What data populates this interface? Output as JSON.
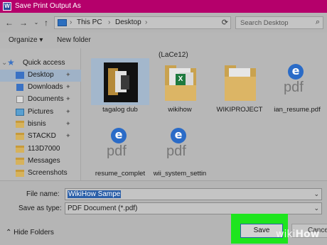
{
  "window": {
    "title": "Save Print Output As",
    "app_icon": "word-icon"
  },
  "address": {
    "segments": [
      "This PC",
      "Desktop"
    ],
    "search_placeholder": "Search Desktop"
  },
  "toolbar": {
    "organize": "Organize ▾",
    "new_folder": "New folder"
  },
  "sidebar": {
    "items": [
      {
        "label": "Quick access",
        "icon": "star-icon",
        "pinned": false
      },
      {
        "label": "Desktop",
        "icon": "desktop-icon",
        "pinned": true,
        "selected": true
      },
      {
        "label": "Downloads",
        "icon": "download-icon",
        "pinned": true
      },
      {
        "label": "Documents",
        "icon": "documents-icon",
        "pinned": true
      },
      {
        "label": "Pictures",
        "icon": "pictures-icon",
        "pinned": true
      },
      {
        "label": "bisnis",
        "icon": "folder-icon",
        "pinned": true
      },
      {
        "label": "STACKD",
        "icon": "folder-icon",
        "pinned": true
      },
      {
        "label": "113D7000",
        "icon": "folder-icon",
        "pinned": false
      },
      {
        "label": "Messages",
        "icon": "folder-icon",
        "pinned": false
      },
      {
        "label": "Screenshots",
        "icon": "folder-icon",
        "pinned": false
      }
    ]
  },
  "content": {
    "group_label": "(LaCe12)",
    "files": [
      {
        "name": "tagalog dub",
        "type": "image-folder",
        "selected": true
      },
      {
        "name": "wikihow",
        "type": "excel-folder"
      },
      {
        "name": "WIKIPROJECT",
        "type": "folder"
      },
      {
        "name": "ian_resume.pdf",
        "type": "pdf",
        "icon_text": "pdf"
      },
      {
        "name": "resume_complet",
        "type": "pdf",
        "icon_text": "pdf"
      },
      {
        "name": "wii_system_settin",
        "type": "pdf",
        "icon_text": "pdf"
      }
    ]
  },
  "form": {
    "file_name_label": "File name:",
    "file_name_value": "WikiHow Sampe",
    "save_type_label": "Save as type:",
    "save_type_value": "PDF Document (*.pdf)"
  },
  "footer": {
    "hide_folders": "Hide Folders",
    "save": "Save",
    "cancel": "Cancel",
    "watermark_wiki": "wiki",
    "watermark_how": "How"
  },
  "colors": {
    "title_bar": "#b5006b",
    "highlight": "#1ee51e",
    "selection": "#2b5fa8"
  }
}
